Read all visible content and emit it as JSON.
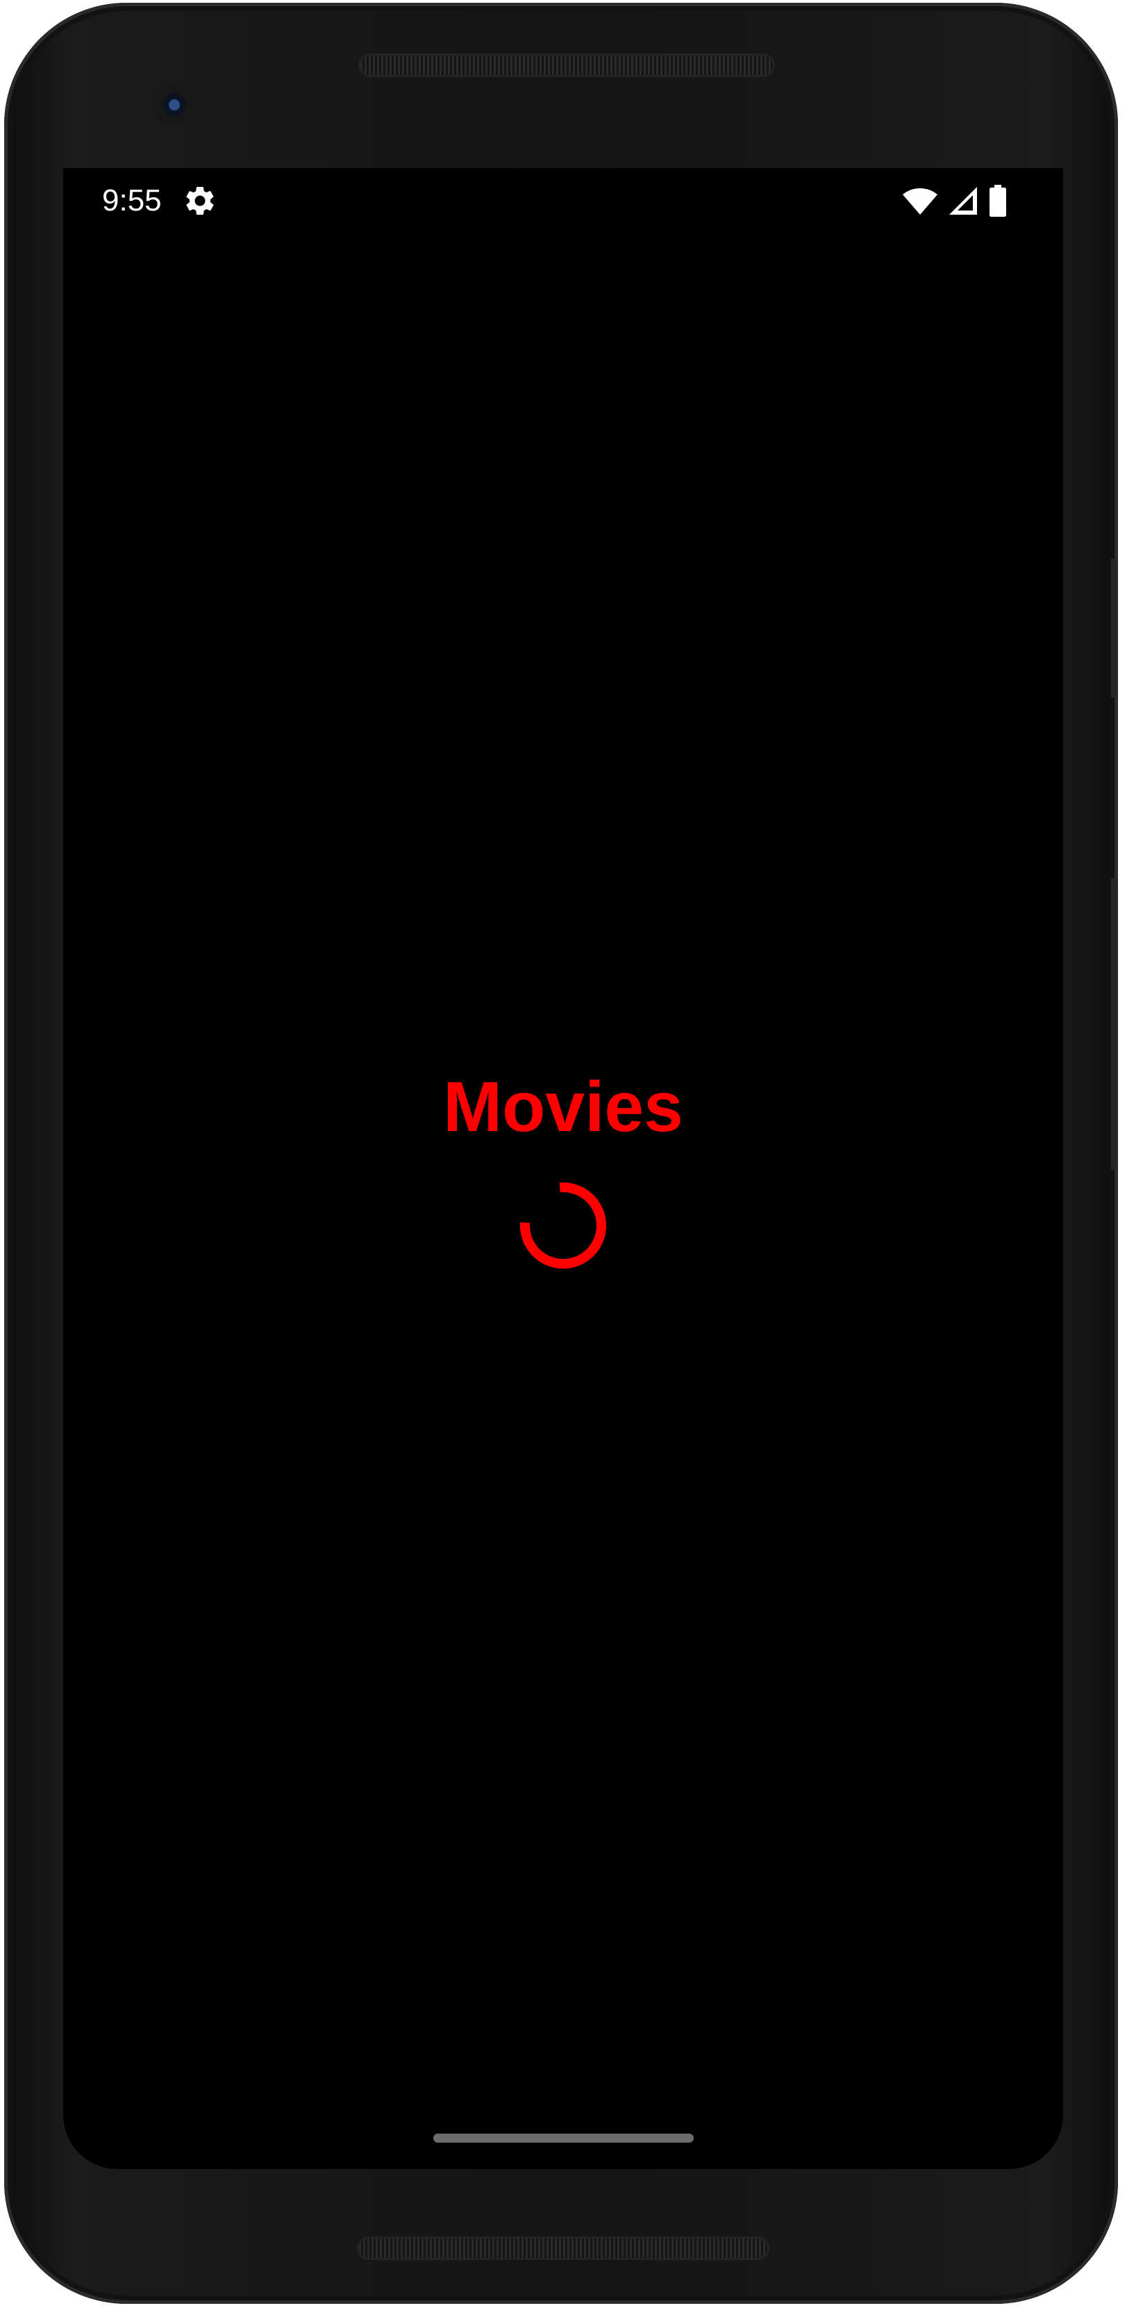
{
  "status_bar": {
    "time": "9:55",
    "left_icons": [
      "settings-gear-icon"
    ],
    "right_icons": [
      "wifi-icon",
      "cell-signal-icon",
      "battery-icon"
    ]
  },
  "splash": {
    "title": "Movies",
    "accent_color": "#ff0000",
    "loading": true
  },
  "navigation": {
    "gesture": "home-pill"
  }
}
